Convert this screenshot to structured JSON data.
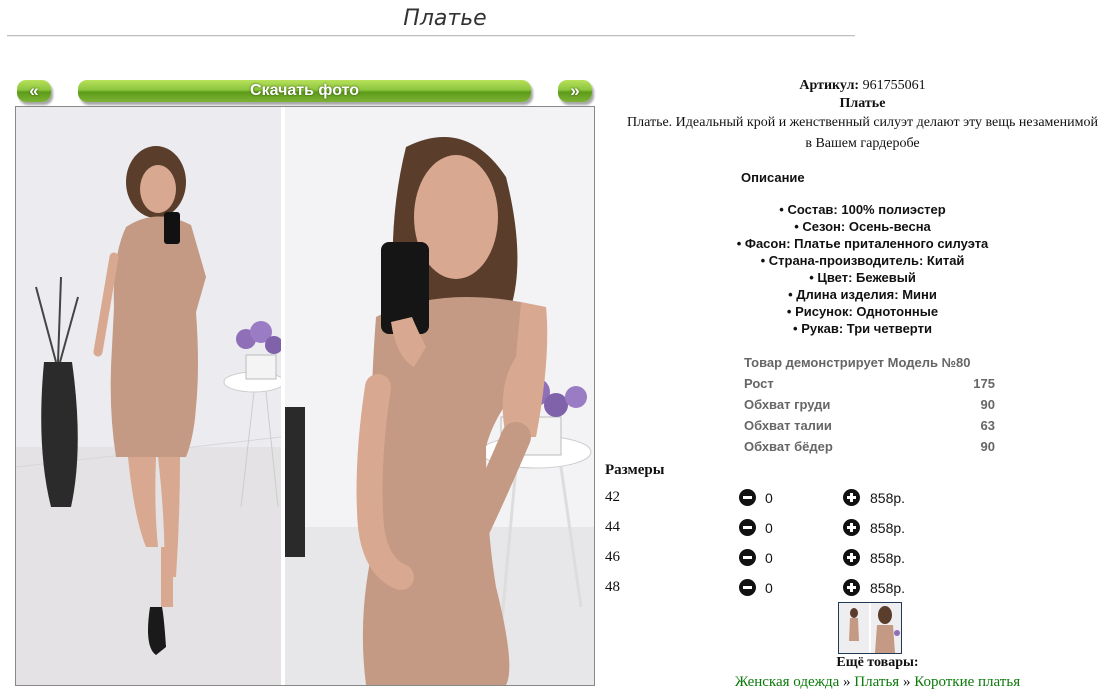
{
  "page": {
    "title": "Платье"
  },
  "gallery": {
    "prev_label": "«",
    "next_label": "»",
    "download_label": "Скачать фото"
  },
  "product": {
    "article_label": "Артикул:",
    "article_value": "961755061",
    "name": "Платье",
    "lead": "Платье. Идеальный крой и женственный силуэт делают эту вещь незаменимой в Вашем гардеробе",
    "description_heading": "Описание",
    "features": [
      "Состав: 100% полиэстер",
      "Сезон: Осень-весна",
      "Фасон: Платье приталенного силуэта",
      "Страна-производитель: Китай",
      "Цвет: Бежевый",
      "Длина изделия: Мини",
      "Рисунок: Однотонные",
      "Рукав: Три четверти"
    ]
  },
  "model": {
    "rows": [
      {
        "label": "Товар демонстрирует Модель №80",
        "value": ""
      },
      {
        "label": "Рост",
        "value": "175"
      },
      {
        "label": "Обхват груди",
        "value": "90"
      },
      {
        "label": "Обхват талии",
        "value": "63"
      },
      {
        "label": "Обхват бёдер",
        "value": "90"
      }
    ]
  },
  "sizes": {
    "heading": "Размеры",
    "rows": [
      {
        "size": "42",
        "qty": "0",
        "price": "858р."
      },
      {
        "size": "44",
        "qty": "0",
        "price": "858р."
      },
      {
        "size": "46",
        "qty": "0",
        "price": "858р."
      },
      {
        "size": "48",
        "qty": "0",
        "price": "858р."
      }
    ]
  },
  "more": {
    "heading": "Ещё товары:",
    "links": [
      "Женская одежда",
      "Платья",
      "Короткие платья"
    ],
    "separator": "»"
  },
  "colors": {
    "button_green": "#8cc63f",
    "link_green": "#0a7a0a",
    "dress": "#c49a85",
    "hair": "#5a3d2b"
  }
}
